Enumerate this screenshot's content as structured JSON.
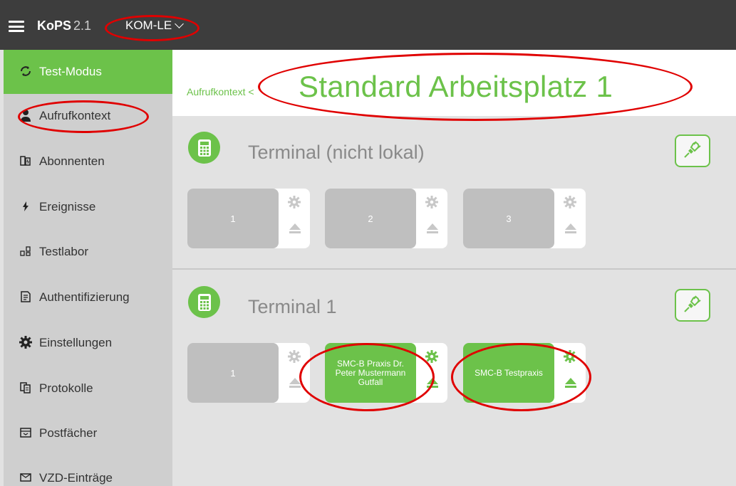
{
  "topbar": {
    "brand": "KoPS",
    "version": "2.1",
    "context": "KOM-LE"
  },
  "sidebar": {
    "items": [
      {
        "label": "Test-Modus",
        "icon": "refresh-icon",
        "active": true
      },
      {
        "label": "Aufrufkontext",
        "icon": "person-icon"
      },
      {
        "label": "Abonnenten",
        "icon": "subscribers-icon"
      },
      {
        "label": "Ereignisse",
        "icon": "lightning-icon"
      },
      {
        "label": "Testlabor",
        "icon": "lab-icon"
      },
      {
        "label": "Authentifizierung",
        "icon": "document-key-icon"
      },
      {
        "label": "Einstellungen",
        "icon": "gear-icon"
      },
      {
        "label": "Protokolle",
        "icon": "copy-document-icon"
      },
      {
        "label": "Postfächer",
        "icon": "mailbox-icon"
      },
      {
        "label": "VZD-Einträge",
        "icon": "envelope-icon"
      }
    ]
  },
  "header": {
    "breadcrumb": "Aufrufkontext <",
    "title": "Standard Arbeitsplatz 1"
  },
  "terminals": [
    {
      "title": "Terminal (nicht lokal)",
      "slots": [
        {
          "label": "1",
          "inserted": false
        },
        {
          "label": "2",
          "inserted": false
        },
        {
          "label": "3",
          "inserted": false
        }
      ]
    },
    {
      "title": "Terminal 1",
      "slots": [
        {
          "label": "1",
          "inserted": false
        },
        {
          "label": "SMC-B Praxis Dr. Peter Mustermann Gutfall",
          "inserted": true
        },
        {
          "label": "SMC-B Testpraxis",
          "inserted": true
        }
      ]
    }
  ],
  "colors": {
    "accent": "#6cc24a",
    "topbar": "#3d3d3d",
    "sidebar": "#cfcfcf",
    "annotation": "#e00000"
  }
}
